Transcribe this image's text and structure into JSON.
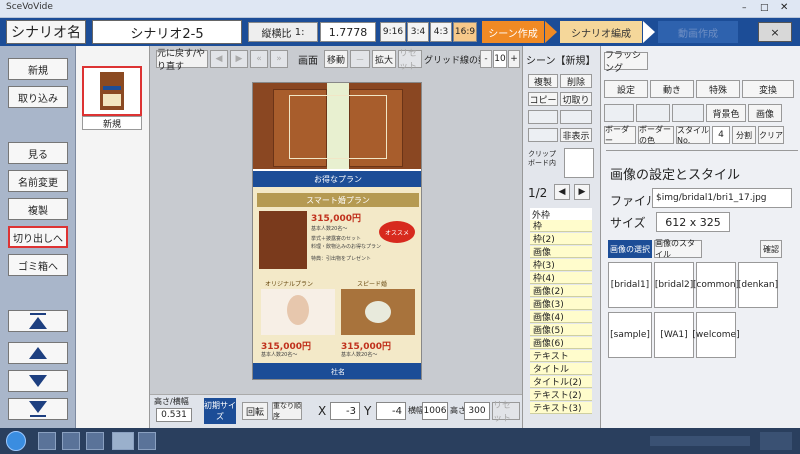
{
  "window": {
    "title": "SceVoVide"
  },
  "topbar": {
    "scenario_label": "シナリオ名",
    "scenario_name": "シナリオ2-5",
    "ratio_label": "縦横比",
    "ratio_prefix": "1:",
    "ratio_value": "1.7778",
    "ratio_options": [
      "9:16",
      "3:4",
      "4:3",
      "16:9"
    ],
    "stages": [
      "シーン作成",
      "シナリオ編成",
      "動画作成"
    ],
    "close_label": "×"
  },
  "left": {
    "top_buttons": [
      "新規",
      "取り込み"
    ],
    "mid_buttons": [
      "見る",
      "名前変更",
      "複製",
      "切り出しへ",
      "ゴミ箱へ"
    ]
  },
  "scenes": {
    "items": [
      {
        "label": "新規"
      }
    ]
  },
  "toolbar": {
    "undo": "元に戻す/やり直す",
    "screen": "画面",
    "move": "移動",
    "zoom": "拡大",
    "reset": "リセット",
    "grid": "グリッド線の数",
    "grid_minus": "-",
    "grid_value": "10",
    "grid_plus": "+"
  },
  "phone": {
    "header": "お得なプラン",
    "plan_title": "スマート婚プラン",
    "main_price": "315,000円",
    "main_note": "基本人数20名～",
    "main_detail": "挙式＋披露宴のセット",
    "main_detail2": "料理・飲物込みのお得なプラン",
    "bonus": "特典：引出物をプレゼント",
    "badge": "オススメ",
    "left_title": "オリジナルプラン",
    "right_title": "スピード婚",
    "left_price": "315,000円",
    "right_price": "315,000円",
    "left_note": "基本人数20名～",
    "right_note": "基本人数20名～",
    "footer": "社名"
  },
  "bottom": {
    "ratio_label": "高さ/横幅",
    "ratio_value": "0.531",
    "original_size": "初期サイズ",
    "rotate": "回転",
    "reorder": "重なり順序",
    "x_label": "X",
    "x_value": "-3",
    "y_label": "Y",
    "y_value": "-4",
    "width_label": "横幅",
    "width_value": "1006",
    "height_label": "高さ",
    "height_value": "300",
    "reset": "リセット"
  },
  "middle": {
    "title": "シーン【新規】",
    "buttons": [
      "複製",
      "削除",
      "コピー",
      "切取り",
      "",
      "",
      "",
      "非表示"
    ],
    "clipboard": "クリップボード内",
    "page": "1/2",
    "list_header": "外枠",
    "elements": [
      "枠",
      "枠(2)",
      "画像",
      "枠(3)",
      "枠(4)",
      "画像(2)",
      "画像(3)",
      "画像(4)",
      "画像(5)",
      "画像(6)",
      "テキスト",
      "タイトル",
      "タイトル(2)",
      "テキスト(2)",
      "テキスト(3)"
    ]
  },
  "right": {
    "flash": "フラッシング",
    "row1": [
      "設定",
      "動き",
      "特殊",
      "変換"
    ],
    "row2": [
      "",
      "",
      "",
      "背景色",
      "画像"
    ],
    "row3_border": "ボーダー",
    "row3_border_color": "ボーダーの色",
    "row3_style": "スタイルNo.",
    "row3_style_value": "4",
    "row3_split": "分割",
    "row3_clear": "クリア",
    "section_title": "画像の設定とスタイル",
    "file_label": "ファイル",
    "file_value": "$img/bridal1/bri1_17.jpg",
    "size_label": "サイズ",
    "size_value": "612 x 325",
    "tab_select": "画像の選択",
    "tab_style": "画像のスタイル",
    "confirm": "確認",
    "image_tags": [
      "[bridal1]",
      "[bridal2]",
      "[common]",
      "[denkan]",
      "[sample]",
      "[WA1]",
      "[welcome]"
    ]
  },
  "colors": {
    "accent": "#1c4d97",
    "stage_active": "#f08a24",
    "stage_next": "#f5d79a",
    "selected_border": "#d33333"
  }
}
